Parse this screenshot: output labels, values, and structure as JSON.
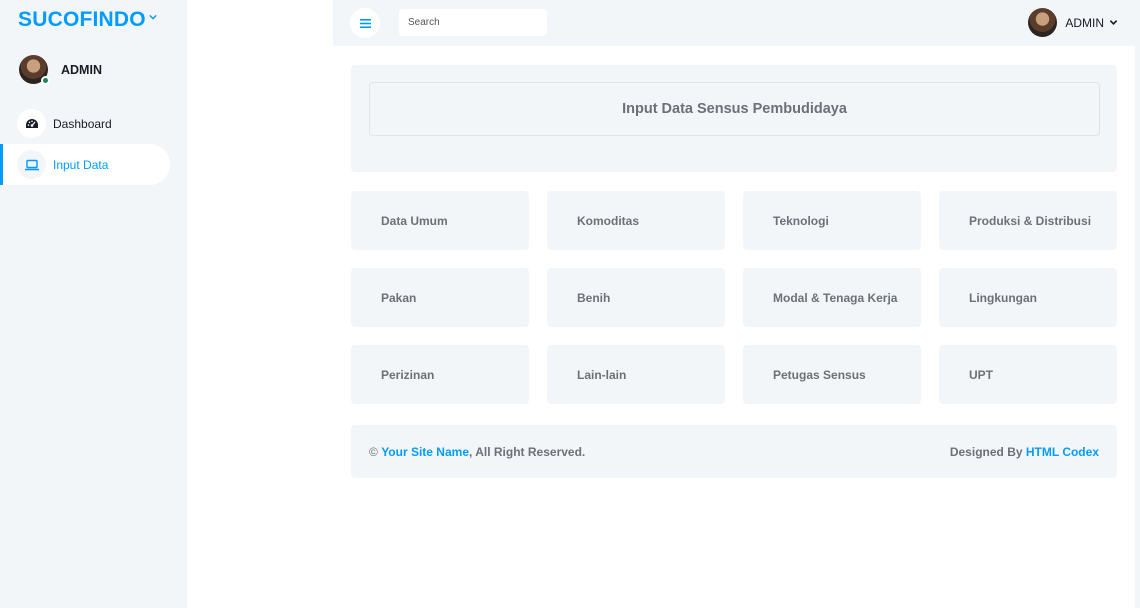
{
  "brand": {
    "title": "SUCOFINDO"
  },
  "sidebar": {
    "user_name": "ADMIN",
    "items": [
      {
        "label": "Dashboard",
        "icon": "tachometer-icon"
      },
      {
        "label": "Input Data",
        "icon": "laptop-icon",
        "active": true
      }
    ]
  },
  "topbar": {
    "search_placeholder": "Search",
    "user_name": "ADMIN"
  },
  "main": {
    "title": "Input Data Sensus Pembudidaya",
    "tiles": [
      "Data Umum",
      "Komoditas",
      "Teknologi",
      "Produksi & Distribusi",
      "Pakan",
      "Benih",
      "Modal & Tenaga Kerja",
      "Lingkungan",
      "Perizinan",
      "Lain-lain",
      "Petugas Sensus",
      "UPT"
    ]
  },
  "footer": {
    "copyright": "©",
    "site_name": "Your Site Name",
    "rights": ", All Right Reserved.",
    "designed_by": "Designed By",
    "designer": "HTML Codex"
  },
  "colors": {
    "accent": "#009CFF",
    "panel": "#f3f6f9",
    "text_muted": "#6c7176"
  }
}
